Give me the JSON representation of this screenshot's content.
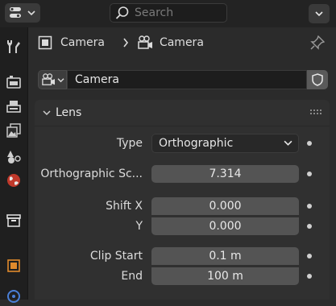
{
  "header": {
    "search_placeholder": "Search"
  },
  "breadcrumb": {
    "object": "Camera",
    "data": "Camera"
  },
  "datablock": {
    "name": "Camera"
  },
  "lens_panel": {
    "title": "Lens",
    "type_label": "Type",
    "type_value": "Orthographic",
    "ortho_scale_label": "Orthographic Sc...",
    "ortho_scale_value": "7.314",
    "shift_x_label": "Shift X",
    "shift_x_value": "0.000",
    "shift_y_label": "Y",
    "shift_y_value": "0.000",
    "clip_start_label": "Clip Start",
    "clip_start_value": "0.1 m",
    "clip_end_label": "End",
    "clip_end_value": "100 m"
  },
  "icons": {
    "editor_type": "properties-editor-icon",
    "search": "search-icon",
    "tabs": [
      "tool-icon",
      "render-icon",
      "output-icon",
      "view-layer-icon",
      "scene-icon",
      "world-icon",
      "collection-icon",
      "object-icon",
      "modifier-icon"
    ]
  },
  "colors": {
    "background": "#2b2b2b",
    "panel": "#303030",
    "field": "#545454",
    "accent_orange": "#e08a2c"
  }
}
